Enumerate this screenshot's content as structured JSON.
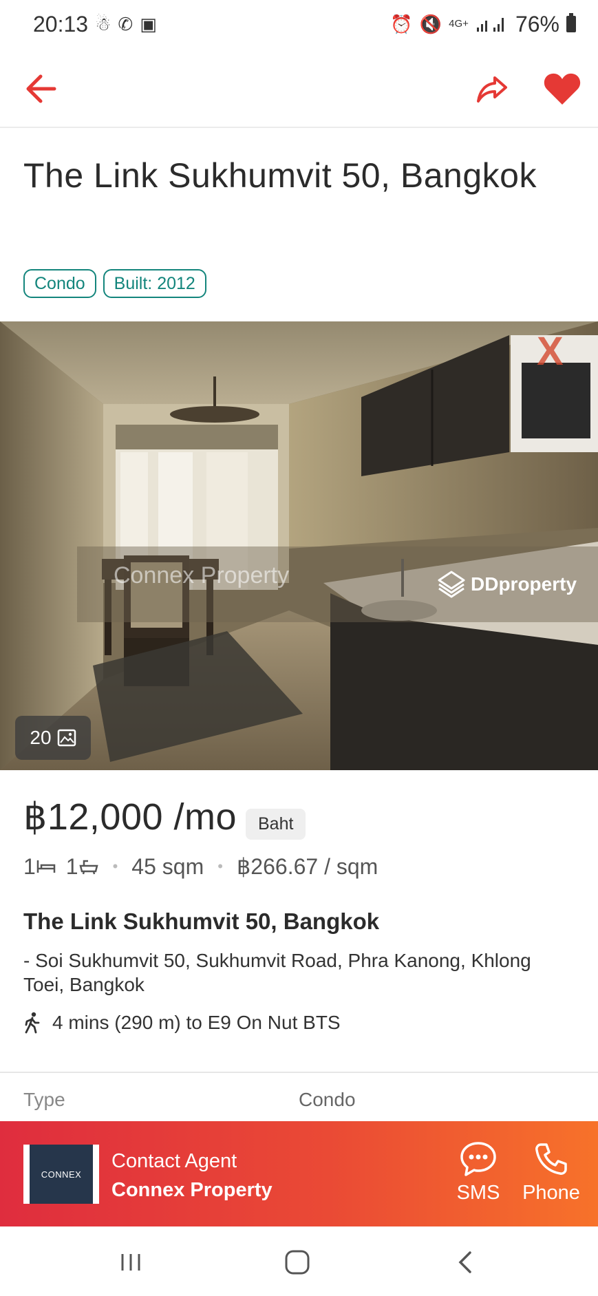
{
  "status_bar": {
    "time": "20:13",
    "network": "4G+",
    "battery": "76%"
  },
  "listing": {
    "title": "The Link Sukhumvit 50, Bangkok",
    "tags": [
      "Condo",
      "Built: 2012"
    ],
    "photo_count": "20",
    "photo_watermarks": [
      "Connex Property",
      "DDproperty"
    ],
    "price": "฿12,000 /mo",
    "currency": "Baht",
    "bedrooms": "1",
    "bathrooms": "1",
    "area": "45 sqm",
    "price_per_sqm": "฿266.67 / sqm",
    "address_title": "The Link Sukhumvit 50, Bangkok",
    "address": "- Soi Sukhumvit 50, Sukhumvit Road, Phra Kanong, Khlong Toei, Bangkok",
    "transit": "4 mins (290 m) to E9 On Nut BTS",
    "type_label": "Type",
    "type_value": "Condo"
  },
  "contact": {
    "label": "Contact Agent",
    "agent_name": "Connex Property",
    "logo_text": "CONNEX",
    "sms_label": "SMS",
    "phone_label": "Phone"
  },
  "colors": {
    "accent": "#e53935",
    "tag_teal": "#13857c",
    "contact_start": "#df2d3e",
    "contact_end": "#f7722a"
  }
}
